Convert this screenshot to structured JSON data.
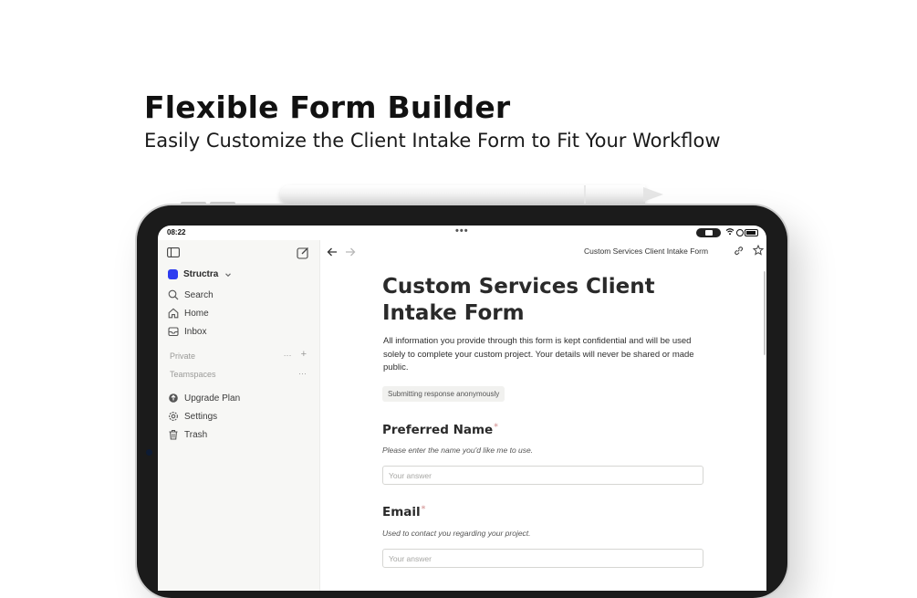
{
  "hero": {
    "title": "Flexible Form Builder",
    "subtitle": "Easily Customize the Client Intake Form to Fit Your Workflow"
  },
  "status_bar": {
    "time": "08:22",
    "dots": "•••"
  },
  "sidebar": {
    "workspace_name": "Structra",
    "nav": [
      {
        "label": "Search",
        "icon": "search-icon"
      },
      {
        "label": "Home",
        "icon": "home-icon"
      },
      {
        "label": "Inbox",
        "icon": "inbox-icon"
      }
    ],
    "sections": {
      "private": "Private",
      "teamspaces": "Teamspaces"
    },
    "more_glyph": "···",
    "add_glyph": "+",
    "utility": [
      {
        "label": "Upgrade Plan",
        "icon": "upgrade-icon"
      },
      {
        "label": "Settings",
        "icon": "gear-icon"
      },
      {
        "label": "Trash",
        "icon": "trash-icon"
      }
    ]
  },
  "topbar": {
    "page_title": "Custom Services Client Intake Form"
  },
  "form": {
    "title": "Custom Services Client Intake Form",
    "description": "All information you provide through this form is kept confidential and will be used solely to complete your custom project. Your details will never be shared or made public.",
    "anonymous_badge": "Submitting response anonymously",
    "questions": [
      {
        "label": "Preferred Name",
        "required_mark": "*",
        "help": "Please enter the name you'd like me to use.",
        "placeholder": "Your answer"
      },
      {
        "label": "Email",
        "required_mark": "*",
        "help": "Used to contact you regarding your project.",
        "placeholder": "Your answer"
      }
    ]
  },
  "colors": {
    "workspace_logo": "#2d3cf0",
    "sidebar_bg": "#f7f7f5",
    "required_mark": "#d9a1a1"
  }
}
